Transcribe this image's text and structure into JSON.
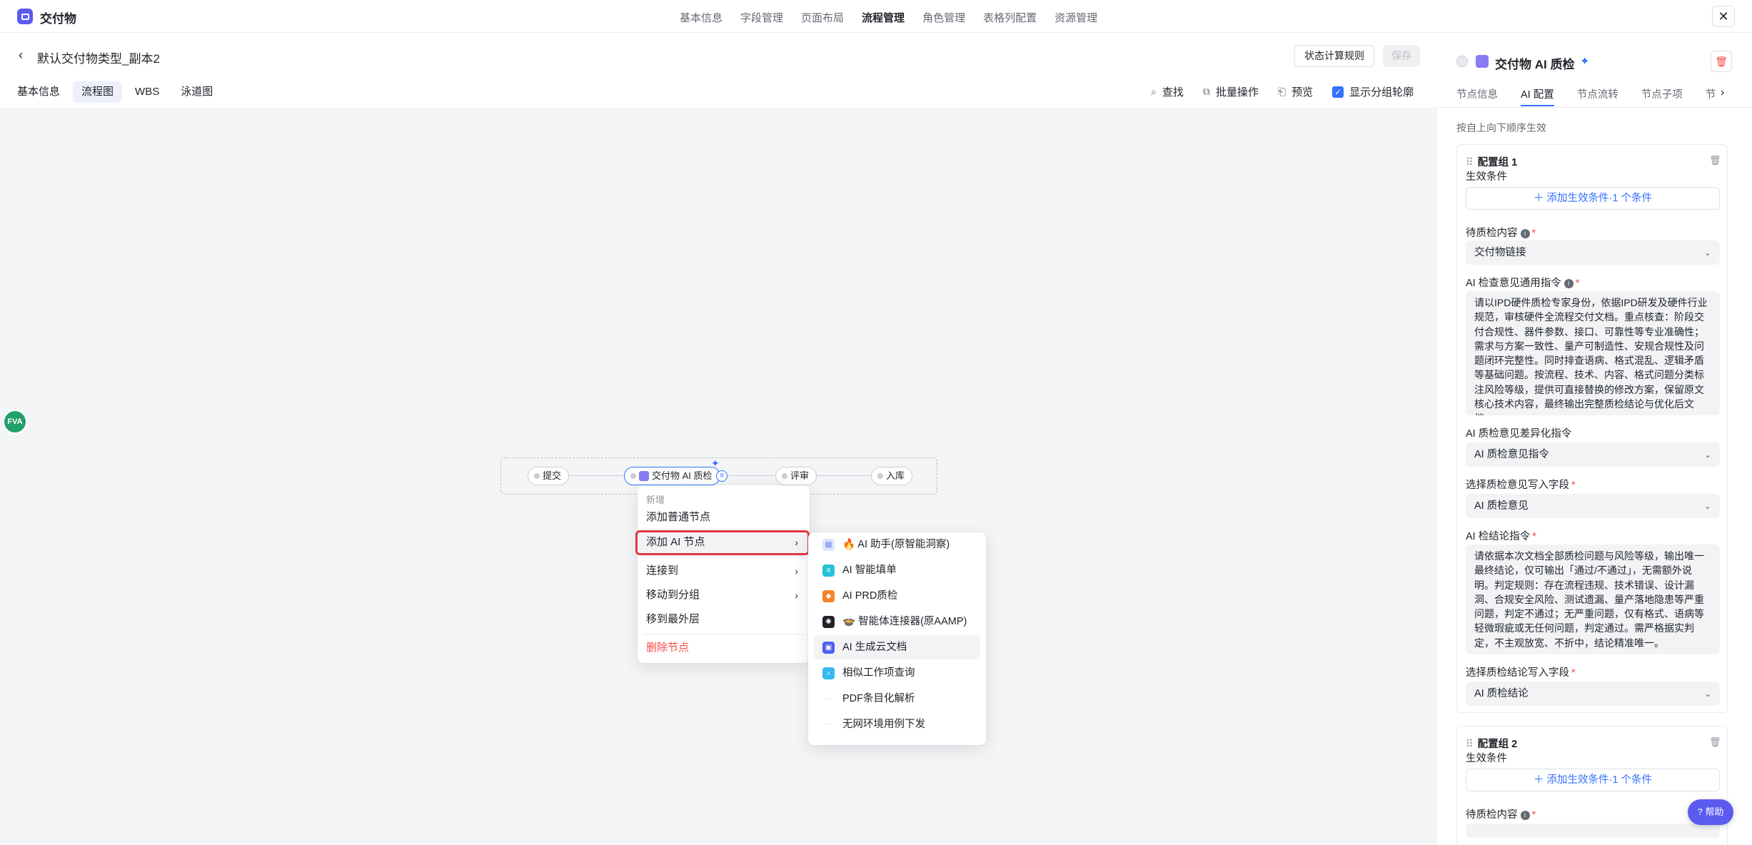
{
  "app": {
    "title": "交付物"
  },
  "top_nav": [
    "基本信息",
    "字段管理",
    "页面布局",
    "流程管理",
    "角色管理",
    "表格列配置",
    "资源管理"
  ],
  "top_nav_active": "流程管理",
  "header": {
    "title": "默认交付物类型_副本2",
    "state_rule_button": "状态计算规则",
    "save_button": "保存"
  },
  "sub_tabs": [
    "基本信息",
    "流程图",
    "WBS",
    "泳道图"
  ],
  "sub_tab_active": "流程图",
  "tools": {
    "find": "查找",
    "batch": "批量操作",
    "preview": "预览",
    "show_outline": "显示分组轮廓"
  },
  "canvas": {
    "avatar": "FVA",
    "nodes": [
      "提交",
      "交付物 AI 质检",
      "评审",
      "入库"
    ]
  },
  "context_menu": {
    "header": "新增",
    "items": {
      "add_normal": "添加普通节点",
      "add_ai": "添加 AI 节点",
      "connect": "连接到",
      "move_group": "移动到分组",
      "move_outer": "移到最外层",
      "delete": "删除节点"
    }
  },
  "ai_submenu": [
    {
      "label": "🔥 AI 助手(原智能洞察)",
      "icon": "assistant-icon",
      "color": "#dbe4fb"
    },
    {
      "label": "AI 智能填单",
      "icon": "form-fill-icon",
      "color": "#27c2d6"
    },
    {
      "label": "AI PRD质检",
      "icon": "prd-check-icon",
      "color": "#f5842c"
    },
    {
      "label": "🍲 智能体连接器(原AAMP)",
      "icon": "agent-connector-icon",
      "color": "#1f2329"
    },
    {
      "label": "AI 生成云文档",
      "icon": "cloud-doc-icon",
      "color": "#4e5ef2"
    },
    {
      "label": "相似工作项查询",
      "icon": "search-similar-icon",
      "color": "#36b8f0"
    },
    {
      "label": "PDF条目化解析",
      "icon": "pdf-parse-icon",
      "color": "#c9cdd4"
    },
    {
      "label": "无网环境用例下发",
      "icon": "offline-case-icon",
      "color": "#c9cdd4"
    }
  ],
  "right_panel": {
    "title": "交付物 AI 质检",
    "tabs": [
      "节点信息",
      "AI 配置",
      "节点流转",
      "节点子项",
      "节"
    ],
    "active_tab": "AI 配置",
    "hint": "按自上向下顺序生效",
    "group1": {
      "title": "配置组 1",
      "effect_label": "生效条件",
      "add_condition": "添加生效条件·1 个条件",
      "content_label": "待质检内容",
      "content_value": "交付物链接",
      "general_prompt_label": "AI 检查意见通用指令",
      "general_prompt": "请以IPD硬件质检专家身份，依据IPD研发及硬件行业规范，审核硬件全流程交付文档。重点核查：阶段交付合规性、器件参数、接口、可靠性等专业准确性；需求与方案一致性、量产可制造性、安规合规性及问题闭环完整性。同时排查语病、格式混乱、逻辑矛盾等基础问题。按流程、技术、内容、格式问题分类标注风险等级，提供可直接替换的修改方案，保留原文核心技术内容，最终输出完整质检结论与优化后文档。",
      "diff_prompt_label": "AI 质检意见差异化指令",
      "diff_prompt_value": "AI 质检意见指令",
      "opinion_field_label": "选择质检意见写入字段",
      "opinion_field_value": "AI 质检意见",
      "conclusion_prompt_label": "AI 检结论指令",
      "conclusion_prompt": "请依据本次文档全部质检问题与风险等级，输出唯一最终结论，仅可输出「通过/不通过」，无需额外说明。判定规则：存在流程违规、技术错误、设计漏洞、合规安全风险、测试遗漏、量产落地隐患等严重问题，判定不通过；无严重问题，仅有格式、语病等轻微瑕疵或无任何问题，判定通过。需严格据实判定，不主观放宽、不折中，结论精准唯一。",
      "conclusion_field_label": "选择质检结论写入字段",
      "conclusion_field_value": "AI 质检结论"
    },
    "group2": {
      "title": "配置组 2",
      "effect_label": "生效条件",
      "add_condition": "添加生效条件·1 个条件",
      "content_label": "待质检内容"
    }
  },
  "help_button": "帮助"
}
